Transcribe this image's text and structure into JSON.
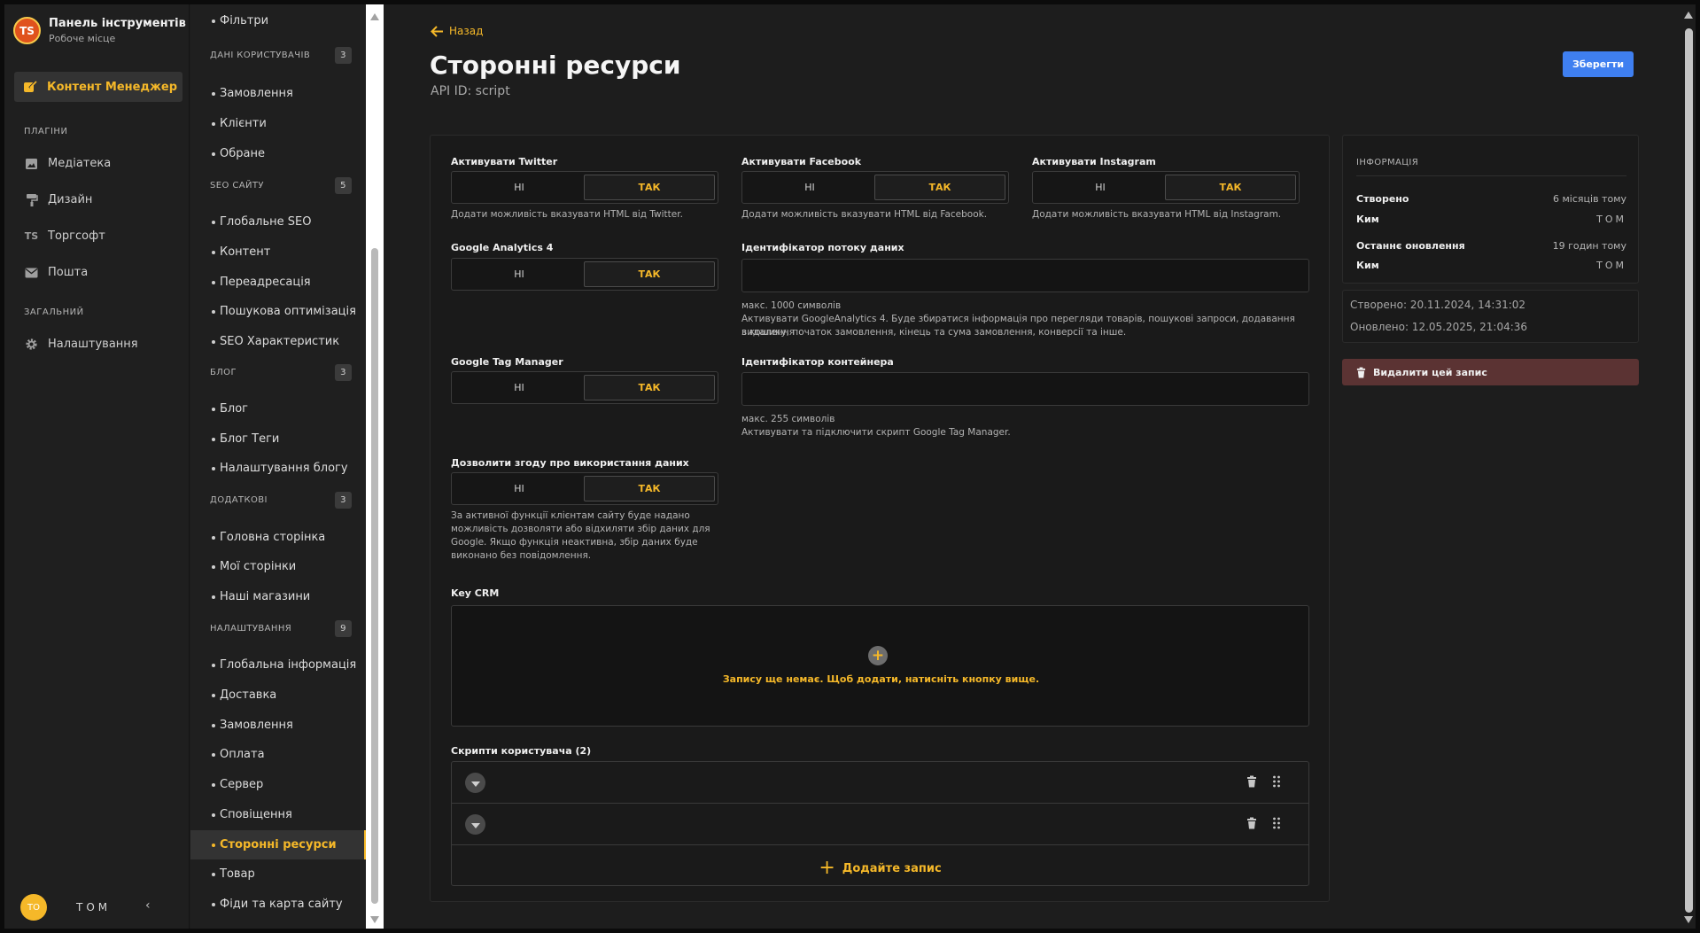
{
  "brand": {
    "logo": "TS",
    "title": "Панель інструментів",
    "subtitle": "Робоче місце"
  },
  "primary_nav": {
    "active": "Контент Менеджер",
    "plugins_label": "ПЛАГІНИ",
    "plugins": [
      {
        "label": "Медіатека",
        "icon": "media-icon"
      },
      {
        "label": "Дизайн",
        "icon": "paint-roller-icon"
      },
      {
        "label": "Торгсофт",
        "icon": "ts-icon"
      },
      {
        "label": "Пошта",
        "icon": "mail-icon"
      }
    ],
    "general_label": "ЗАГАЛЬНИЙ",
    "general": [
      {
        "label": "Налаштування",
        "icon": "gear-icon"
      }
    ]
  },
  "user": {
    "initials": "TO",
    "name": "TOM"
  },
  "secondary_nav": {
    "top_item": "Фільтри",
    "groups": [
      {
        "title": "ДАНІ КОРИСТУВАЧІВ",
        "count": "3",
        "items": [
          "Замовлення",
          "Клієнти",
          "Обране"
        ]
      },
      {
        "title": "SEO САЙТУ",
        "count": "5",
        "items": [
          "Глобальне SEO",
          "Контент",
          "Переадресація",
          "Пошукова оптимізація",
          "SEO Характеристик"
        ]
      },
      {
        "title": "БЛОГ",
        "count": "3",
        "items": [
          "Блог",
          "Блог Теги",
          "Налаштування блогу"
        ]
      },
      {
        "title": "ДОДАТКОВІ",
        "count": "3",
        "items": [
          "Головна сторінка",
          "Мої сторінки",
          "Наші магазини"
        ]
      },
      {
        "title": "НАЛАШТУВАННЯ",
        "count": "9",
        "items": [
          "Глобальна інформація",
          "Доставка",
          "Замовлення",
          "Оплата",
          "Сервер",
          "Сповіщення",
          "Сторонні ресурси",
          "Товар",
          "Фіди та карта сайту"
        ]
      }
    ]
  },
  "main": {
    "back": "Назад",
    "title": "Сторонні ресурси",
    "api_id": "API ID: script",
    "save": "Зберегти"
  },
  "form": {
    "no": "НІ",
    "yes": "ТАК",
    "twitter": {
      "label": "Активувати Twitter",
      "help": "Додати можливість вказувати HTML від Twitter."
    },
    "facebook": {
      "label": "Активувати Facebook",
      "help": "Додати можливість вказувати HTML від Facebook."
    },
    "instagram": {
      "label": "Активувати Instagram",
      "help": "Додати можливість вказувати HTML від Instagram."
    },
    "ga4": {
      "label": "Google Analytics 4"
    },
    "stream_id": {
      "label": "Ідентифікатор потоку даних",
      "max": "макс. 1000 символів",
      "help1": "Активувати GoogleAnalytics 4. Буде збиратися інформація про перегляди товарів, пошукові запроси, додавання видалення",
      "help2": "з кошику, початок замовлення, кінець та сума замовлення, конверсії та інше."
    },
    "gtm": {
      "label": "Google Tag Manager"
    },
    "container_id": {
      "label": "Ідентифікатор контейнера",
      "max": "макс. 255 символів",
      "help": "Активувати та підключити скрипт Google Tag Manager."
    },
    "consent": {
      "label": "Дозволити згоду про використання даних",
      "help1": "За активної функції клієнтам сайту буде надано",
      "help2": "можливість дозволяти або відхиляти збір даних для",
      "help3": "Google. Якщо функція неактивна, збір даних буде",
      "help4": "виконано без повідомлення."
    },
    "keycrm": {
      "label": "Key CRM",
      "empty": "Запису ще немає. Щоб додати, натисніть кнопку вище."
    },
    "scripts": {
      "label": "Скрипти користувача (2)",
      "add": "Додайте запис"
    }
  },
  "info": {
    "title": "ІНФОРМАЦІЯ",
    "created_label": "Створено",
    "created_value": "6 місяців тому",
    "by_label": "Ким",
    "by_value": "TOM",
    "updated_label": "Останнє оновлення",
    "updated_value": "19 годин тому",
    "by2_value": "TOM",
    "created_date": "Створено: 20.11.2024, 14:31:02",
    "updated_date": "Оновлено: 12.05.2025, 21:04:36",
    "delete": "Видалити цей запис"
  },
  "colors": {
    "accent": "#f5b829",
    "primary_button": "#3f7ff0",
    "danger_button": "#5b3333"
  }
}
